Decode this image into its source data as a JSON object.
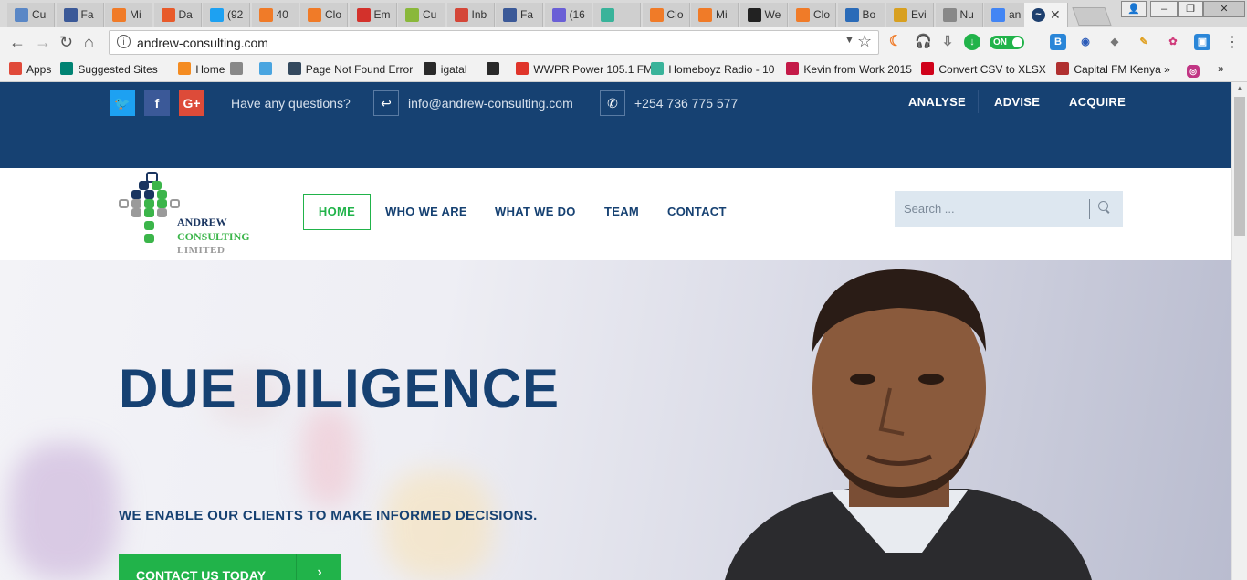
{
  "browser": {
    "tabs": [
      {
        "label": "Cu",
        "icon": "chrome-icon",
        "color": "#5a87c6"
      },
      {
        "label": "Fa",
        "icon": "facebook-icon",
        "color": "#3b5998"
      },
      {
        "label": "Mi",
        "icon": "orange-square-icon",
        "color": "#f07b28"
      },
      {
        "label": "Da",
        "icon": "diamond-icon",
        "color": "#e85a2a"
      },
      {
        "label": "(92",
        "icon": "twitter-icon",
        "color": "#1da1f2"
      },
      {
        "label": "40",
        "icon": "orange-square-icon",
        "color": "#f07b28"
      },
      {
        "label": "Clo",
        "icon": "orange-square-icon",
        "color": "#f07b28"
      },
      {
        "label": "Em",
        "icon": "zoho-icon",
        "color": "#d3312b"
      },
      {
        "label": "Cu",
        "icon": "android-icon",
        "color": "#8ab83b"
      },
      {
        "label": "Inb",
        "icon": "gmail-icon",
        "color": "#d44638"
      },
      {
        "label": "Fa",
        "icon": "facebook-icon",
        "color": "#3b5998"
      },
      {
        "label": "(16",
        "icon": "mail-icon",
        "color": "#6a5fd6"
      },
      {
        "label": "",
        "icon": "homeboyz-icon",
        "color": "#39b39a"
      },
      {
        "label": "Clo",
        "icon": "orange-square-icon",
        "color": "#f07b28"
      },
      {
        "label": "Mi",
        "icon": "orange-square-icon",
        "color": "#f07b28"
      },
      {
        "label": "We",
        "icon": "h-icon",
        "color": "#222222"
      },
      {
        "label": "Clo",
        "icon": "orange-square-icon",
        "color": "#f07b28"
      },
      {
        "label": "Bo",
        "icon": "bootstrap-icon",
        "color": "#2a6bb8"
      },
      {
        "label": "Evi",
        "icon": "p-icon",
        "color": "#d8a020"
      },
      {
        "label": "Nu",
        "icon": "loading-icon",
        "color": "#888888"
      },
      {
        "label": "an",
        "icon": "google-icon",
        "color": "#4285f4"
      }
    ],
    "active_tab_icon": "andrew-consulting-icon",
    "url": "andrew-consulting.com",
    "bookmarks": [
      {
        "label": "Apps",
        "icon": "apps-grid-icon",
        "color": "#e04a3a"
      },
      {
        "label": "Suggested Sites",
        "icon": "bing-icon",
        "color": "#008373"
      },
      {
        "label": "Home",
        "icon": "joomla-icon",
        "color": "#f48c22"
      },
      {
        "label": "",
        "icon": "loading-icon",
        "color": "#888888"
      },
      {
        "label": "",
        "icon": "m-circle-icon",
        "color": "#4aa5e0"
      },
      {
        "label": "Page Not Found Error",
        "icon": "p-box-icon",
        "color": "#34495e"
      },
      {
        "label": "igatal",
        "icon": "olx-icon",
        "color": "#2a2a2a"
      },
      {
        "label": "",
        "icon": "olx-icon",
        "color": "#2a2a2a"
      },
      {
        "label": "WWPR Power 105.1 FM",
        "icon": "radio-icon",
        "color": "#e0352b"
      },
      {
        "label": "Homeboyz Radio - 10",
        "icon": "homeboyz-icon",
        "color": "#39b39a"
      },
      {
        "label": "Kevin from Work 2015",
        "icon": "ez-icon",
        "color": "#c41a48"
      },
      {
        "label": "Convert CSV to XLSX",
        "icon": "no-entry-icon",
        "color": "#d0021b"
      },
      {
        "label": "Capital FM Kenya »",
        "icon": "capital-fm-icon",
        "color": "#b03030"
      }
    ]
  },
  "site": {
    "colors": {
      "navy": "#164172",
      "green": "#21b34a"
    },
    "topbar": {
      "question": "Have any questions?",
      "email": "info@andrew-consulting.com",
      "phone": "+254 736 775 577",
      "nav": [
        "ANALYSE",
        "ADVISE",
        "ACQUIRE"
      ],
      "social": [
        "twitter-icon",
        "facebook-icon",
        "google-plus-icon"
      ]
    },
    "logo": {
      "line1": "ANDREW",
      "line2": "CONSULTING",
      "line3": "LIMITED"
    },
    "nav": {
      "home": "HOME",
      "who": "WHO WE ARE",
      "what": "WHAT WE DO",
      "team": "TEAM",
      "contact": "CONTACT"
    },
    "search": {
      "placeholder": "Search ..."
    },
    "hero": {
      "title": "DUE DILIGENCE",
      "subtitle": "WE ENABLE OUR CLIENTS TO MAKE INFORMED DECISIONS.",
      "cta": "CONTACT US TODAY"
    }
  }
}
